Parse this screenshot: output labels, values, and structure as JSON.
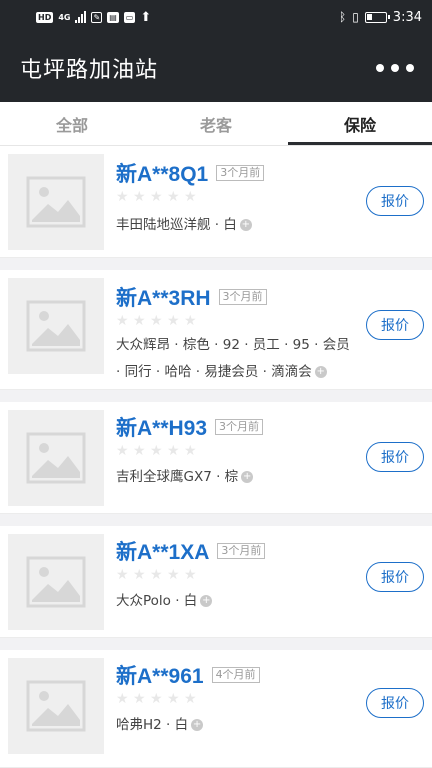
{
  "status_bar": {
    "left_badges": [
      "HD",
      "4G"
    ],
    "time": "3:34"
  },
  "header": {
    "title": "屯坪路加油站",
    "more_icon": "more-dots-icon"
  },
  "tabs": [
    {
      "label": "全部",
      "active": false
    },
    {
      "label": "老客",
      "active": false
    },
    {
      "label": "保险",
      "active": true
    }
  ],
  "items": [
    {
      "plate": "新A**8Q1",
      "time": "3个月前",
      "rating": 0,
      "desc": "丰田陆地巡洋舰 · 白",
      "quote": "报价"
    },
    {
      "plate": "新A**3RH",
      "time": "3个月前",
      "rating": 0,
      "desc": "大众辉昂 · 棕色 · 92 · 员工 · 95 · 会员 · 同行 · 哈哈 · 易捷会员 · 滴滴会",
      "quote": "报价"
    },
    {
      "plate": "新A**H93",
      "time": "3个月前",
      "rating": 0,
      "desc": "吉利全球鹰GX7 · 棕",
      "quote": "报价"
    },
    {
      "plate": "新A**1XA",
      "time": "3个月前",
      "rating": 0,
      "desc": "大众Polo · 白",
      "quote": "报价"
    },
    {
      "plate": "新A**961",
      "time": "4个月前",
      "rating": 0,
      "desc": "哈弗H2 · 白",
      "quote": "报价"
    }
  ]
}
